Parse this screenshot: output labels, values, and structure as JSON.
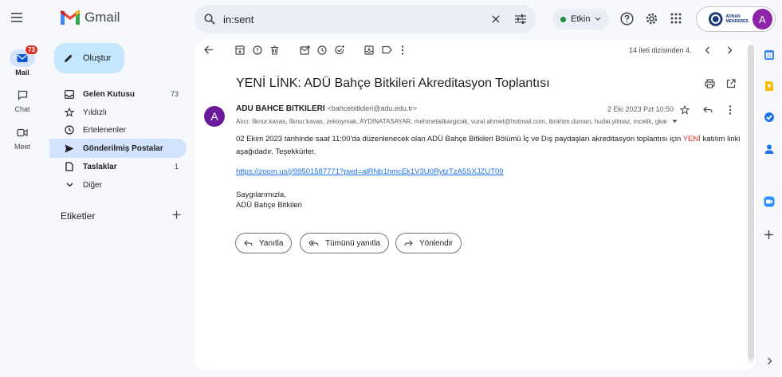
{
  "header": {
    "app_name": "Gmail",
    "search_value": "in:sent",
    "status_label": "Etkin"
  },
  "rail": {
    "mail_label": "Mail",
    "mail_badge": "73",
    "chat_label": "Chat",
    "meet_label": "Meet"
  },
  "nav": {
    "compose_label": "Oluştur",
    "items": [
      {
        "label": "Gelen Kutusu",
        "count": "73"
      },
      {
        "label": "Yıldızlı",
        "count": ""
      },
      {
        "label": "Ertelenenler",
        "count": ""
      },
      {
        "label": "Gönderilmiş Postalar",
        "count": ""
      },
      {
        "label": "Taslaklar",
        "count": "1"
      },
      {
        "label": "Diğer",
        "count": ""
      }
    ],
    "labels_heading": "Etiketler"
  },
  "toolbar": {
    "pagination": "14 ileti dizisinden 4."
  },
  "email": {
    "subject": "YENİ LİNK: ADÜ Bahçe Bitkileri Akreditasyon Toplantısı",
    "avatar_letter": "A",
    "sender_name": "ADU BAHCE BITKILERI",
    "sender_email": "<bahcebitkileri@adu.edu.tr>",
    "recipients": "Alıcı: İlknur.kavas, İlknur.kavas, zekioymak, AYDINATASAYAR, mehmetalikargicak, vural.ahmet@hotmail.com, ibrahim.duman, hudai.yilmaz, mcelik, gkar",
    "date": "2 Eki 2023 Pzt 10:50",
    "body_part1": "02 Ekim 2023 tarihinde saat 11:00'da düzenlenecek olan ADÜ Bahçe Bitkileri Bölümü İç ve Dış paydaşları akreditasyon toplantısı için ",
    "body_highlight": "YENİ",
    "body_part2": " katılım linki aşağıdadır. Teşekkürler.",
    "link": "https://zoom.us/j/99501587771?pwd=alRNb1hmcEk1V3U0RytzTzA5SXJZUT09",
    "signature_line1": "Saygılarımızla,",
    "signature_line2": "ADÜ Bahçe Bitkileri"
  },
  "actions": {
    "reply": "Yanıtla",
    "reply_all": "Tümünü yanıtla",
    "forward": "Yönlendir"
  },
  "profile": {
    "avatar_letter": "A",
    "org_logo_text": "ADNAN MENDERES"
  },
  "colors": {
    "accent": "#0b57d0",
    "compose_bg": "#c2e7ff",
    "active_nav": "#d3e3fd",
    "status_green": "#1e8e3e",
    "highlight_red": "#d93025"
  }
}
